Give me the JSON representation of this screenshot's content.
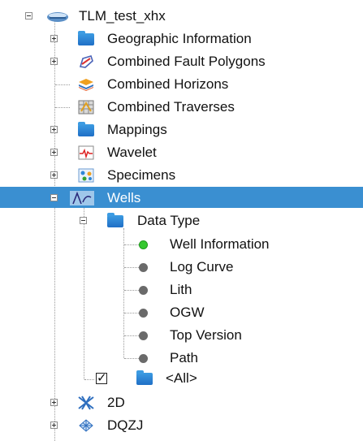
{
  "tree": {
    "root": {
      "label": "TLM_test_xhx",
      "icon": "database-icon",
      "expanded": true
    },
    "items": [
      {
        "label": "Geographic Information",
        "icon": "folder-icon",
        "expanded": false
      },
      {
        "label": "Combined Fault Polygons",
        "icon": "fault-polygon-icon",
        "expanded": false
      },
      {
        "label": "Combined Horizons",
        "icon": "horizon-layers-icon",
        "expanded": false
      },
      {
        "label": "Combined Traverses",
        "icon": "traverse-grid-icon",
        "expanded": false
      },
      {
        "label": "Mappings",
        "icon": "folder-icon",
        "expanded": false
      },
      {
        "label": "Wavelet",
        "icon": "wavelet-icon",
        "expanded": false
      },
      {
        "label": "Specimens",
        "icon": "specimens-icon",
        "expanded": false
      },
      {
        "label": "Wells",
        "icon": "wells-icon",
        "expanded": true,
        "selected": true
      },
      {
        "label": "Data Type",
        "icon": "folder-icon",
        "expanded": true
      },
      {
        "label": "Well Information",
        "icon": "green-dot-icon"
      },
      {
        "label": "Log Curve",
        "icon": "gray-dot-icon"
      },
      {
        "label": "Lith",
        "icon": "gray-dot-icon"
      },
      {
        "label": "OGW",
        "icon": "gray-dot-icon"
      },
      {
        "label": "Top Version",
        "icon": "gray-dot-icon"
      },
      {
        "label": "Path",
        "icon": "gray-dot-icon"
      },
      {
        "label": "<All>",
        "icon": "folder-icon",
        "checked": true
      },
      {
        "label": "2D",
        "icon": "seismic-2d-icon",
        "expanded": false
      },
      {
        "label": "DQZJ",
        "icon": "seismic-3d-icon",
        "expanded": false
      }
    ]
  },
  "colors": {
    "selection": "#3a8fd1",
    "folder": "#2f86d6",
    "green_dot": "#35c82f",
    "gray_dot": "#6a6a6a"
  }
}
